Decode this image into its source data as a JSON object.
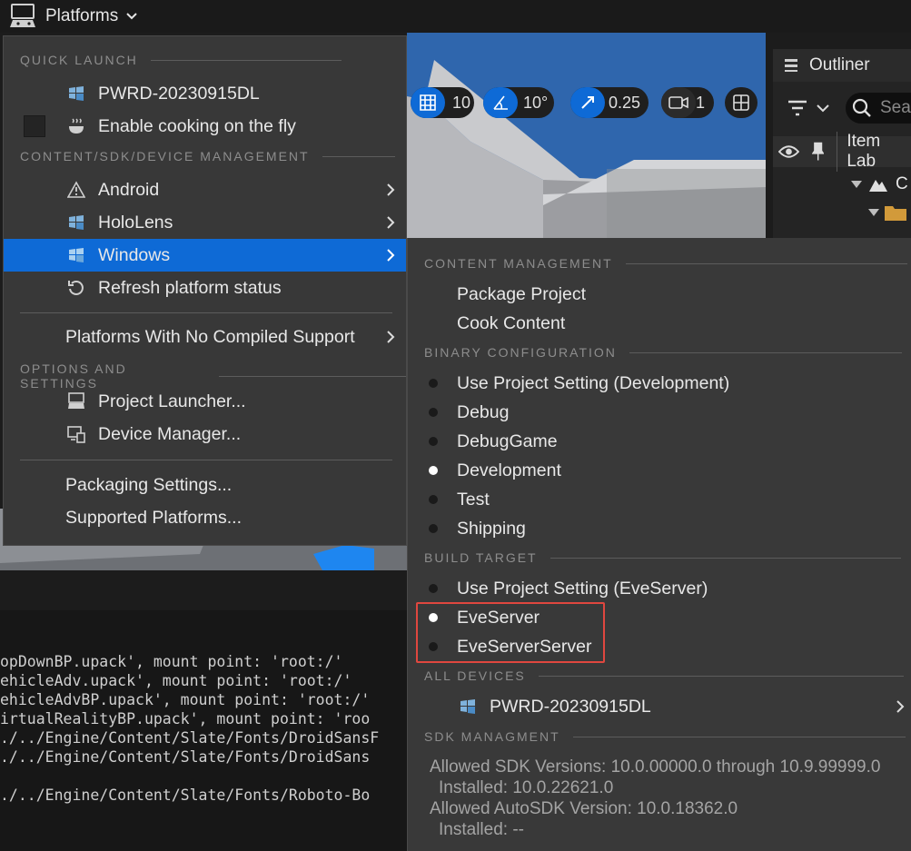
{
  "topbar": {
    "platforms_label": "Platforms"
  },
  "viewport": {
    "grid_snap": "10",
    "rotation_snap": "10°",
    "scale_snap": "0.25",
    "camera_speed": "1"
  },
  "outliner": {
    "title": "Outliner",
    "search_placeholder": "Sea",
    "column_item_label": "Item Lab",
    "row_fragment": "C"
  },
  "menu": {
    "quick_launch_header": "QUICK LAUNCH",
    "device_label": "PWRD-20230915DL",
    "cook_on_fly_label": "Enable cooking on the fly",
    "content_header": "CONTENT/SDK/DEVICE MANAGEMENT",
    "platforms": [
      {
        "label": "Android",
        "icon": "warning-icon"
      },
      {
        "label": "HoloLens",
        "icon": "hololens-icon"
      },
      {
        "label": "Windows",
        "icon": "windows-icon"
      }
    ],
    "refresh_label": "Refresh platform status",
    "no_compiled_label": "Platforms With No Compiled Support",
    "options_header": "OPTIONS AND SETTINGS",
    "project_launcher_label": "Project Launcher...",
    "device_manager_label": "Device Manager...",
    "packaging_settings_label": "Packaging Settings...",
    "supported_platforms_label": "Supported Platforms..."
  },
  "submenu": {
    "content_header": "CONTENT MANAGEMENT",
    "package_project": "Package Project",
    "cook_content": "Cook Content",
    "binary_header": "BINARY CONFIGURATION",
    "binary_options": [
      {
        "label": "Use Project Setting (Development)",
        "selected": false
      },
      {
        "label": "Debug",
        "selected": false
      },
      {
        "label": "DebugGame",
        "selected": false
      },
      {
        "label": "Development",
        "selected": true
      },
      {
        "label": "Test",
        "selected": false
      },
      {
        "label": "Shipping",
        "selected": false
      }
    ],
    "build_header": "BUILD TARGET",
    "build_options": [
      {
        "label": "Use Project Setting (EveServer)",
        "selected": false
      },
      {
        "label": "EveServer",
        "selected": true
      },
      {
        "label": "EveServerServer",
        "selected": false
      }
    ],
    "devices_header": "ALL DEVICES",
    "device_label": "PWRD-20230915DL",
    "sdk_header": "SDK MANAGMENT",
    "sdk_allowed": "Allowed SDK Versions: 10.0.00000.0 through 10.9.99999.0",
    "sdk_installed": "Installed: 10.0.22621.0",
    "autosdk_allowed": "Allowed AutoSDK Version: 10.0.18362.0",
    "autosdk_installed": "Installed: --"
  },
  "log": {
    "lines": [
      "opDownBP.upack', mount point: 'root:/'",
      "ehicleAdv.upack', mount point: 'root:/'",
      "ehicleAdvBP.upack', mount point: 'root:/'",
      "irtualRealityBP.upack', mount point: 'roo",
      "./../Engine/Content/Slate/Fonts/DroidSansF",
      "./../Engine/Content/Slate/Fonts/DroidSans",
      "",
      "./../Engine/Content/Slate/Fonts/Roboto-Bo"
    ]
  }
}
